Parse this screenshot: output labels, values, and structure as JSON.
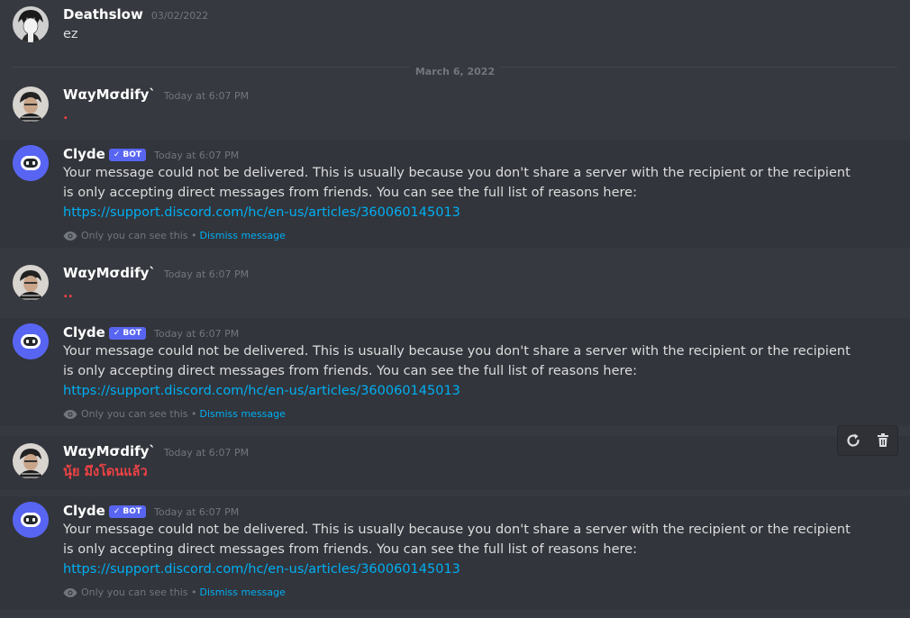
{
  "messages": [
    {
      "author": "Deathslow",
      "timestamp": "03/02/2022",
      "text": "ez"
    },
    {
      "author": "WαyMσdify`",
      "timestamp": "Today at 6:07 PM",
      "text": "."
    },
    {
      "author": "Clyde",
      "badge": "BOT",
      "timestamp": "Today at 6:07 PM",
      "text": "Your message could not be delivered. This is usually because you don't share a server with the recipient or the recipient is only accepting direct messages from friends. You can see the full list of reasons here: ",
      "link": "https://support.discord.com/hc/en-us/articles/360060145013",
      "ephemeral": "Only you can see this •",
      "dismiss": "Dismiss message"
    },
    {
      "author": "WαyMσdify`",
      "timestamp": "Today at 6:07 PM",
      "text": ".."
    },
    {
      "author": "Clyde",
      "badge": "BOT",
      "timestamp": "Today at 6:07 PM",
      "text": "Your message could not be delivered. This is usually because you don't share a server with the recipient or the recipient is only accepting direct messages from friends. You can see the full list of reasons here: ",
      "link": "https://support.discord.com/hc/en-us/articles/360060145013",
      "ephemeral": "Only you can see this •",
      "dismiss": "Dismiss message"
    },
    {
      "author": "WαyMσdify`",
      "timestamp": "Today at 6:07 PM",
      "text": "นุ้ย มึงโดนแล้ว"
    },
    {
      "author": "Clyde",
      "badge": "BOT",
      "timestamp": "Today at 6:07 PM",
      "text": "Your message could not be delivered. This is usually because you don't share a server with the recipient or the recipient is only accepting direct messages from friends. You can see the full list of reasons here: ",
      "link": "https://support.discord.com/hc/en-us/articles/360060145013",
      "ephemeral": "Only you can see this •",
      "dismiss": "Dismiss message"
    }
  ],
  "divider": "March 6, 2022",
  "toolbar": {
    "retry_icon": "retry-icon",
    "delete_icon": "trash-icon"
  },
  "colors": {
    "background": "#36393f",
    "link": "#00aff4",
    "bot_badge": "#5865f2",
    "error_text": "#ed4245",
    "clyde": "#5865f2"
  }
}
